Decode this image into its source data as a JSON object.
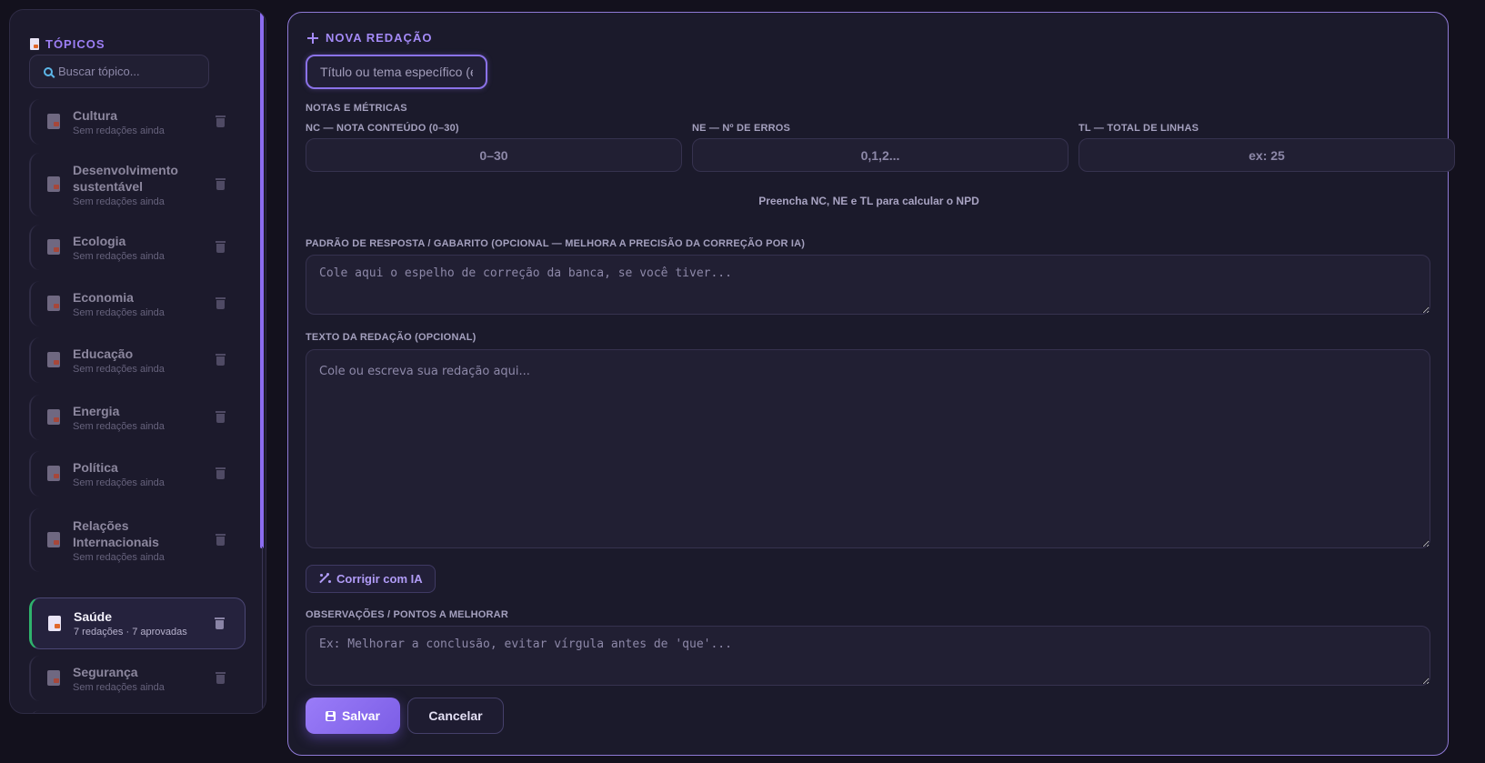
{
  "sidebar": {
    "title": "TÓPICOS",
    "search_placeholder": "Buscar tópico...",
    "topics": [
      {
        "name": "Cultura",
        "sub": "Sem redações ainda"
      },
      {
        "name": "Desenvolvimento sustentável",
        "sub": "Sem redações ainda"
      },
      {
        "name": "Ecologia",
        "sub": "Sem redações ainda"
      },
      {
        "name": "Economia",
        "sub": "Sem redações ainda"
      },
      {
        "name": "Educação",
        "sub": "Sem redações ainda"
      },
      {
        "name": "Energia",
        "sub": "Sem redações ainda"
      },
      {
        "name": "Política",
        "sub": "Sem redações ainda"
      },
      {
        "name": "Relações Internacionais",
        "sub": "Sem redações ainda"
      },
      {
        "name": "Saúde",
        "sub": "7 redações · 7 aprovadas",
        "active": true
      },
      {
        "name": "Segurança",
        "sub": "Sem redações ainda"
      }
    ]
  },
  "form": {
    "title": "NOVA REDAÇÃO",
    "title_placeholder": "Título ou tema específico (ex: ...)",
    "metrics_heading": "NOTAS E MÉTRICAS",
    "nc_label": "NC — NOTA CONTEÚDO (0–30)",
    "nc_placeholder": "0–30",
    "ne_label": "NE — Nº DE ERROS",
    "ne_placeholder": "0,1,2...",
    "tl_label": "TL — TOTAL DE LINHAS",
    "tl_placeholder": "ex: 25",
    "npd_hint": "Preencha NC, NE e TL para calcular o NPD",
    "gabarito_label": "PADRÃO DE RESPOSTA / GABARITO (OPCIONAL — MELHORA A PRECISÃO DA CORREÇÃO POR IA)",
    "gabarito_placeholder": "Cole aqui o espelho de correção da banca, se você tiver...",
    "texto_label": "TEXTO DA REDAÇÃO (OPCIONAL)",
    "texto_placeholder": "Cole ou escreva sua redação aqui...",
    "ai_button": "Corrigir com IA",
    "obs_label": "OBSERVAÇÕES / PONTOS A MELHORAR",
    "obs_placeholder": "Ex: Melhorar a conclusão, evitar vírgula antes de 'que'...",
    "save_button": "Salvar",
    "cancel_button": "Cancelar"
  },
  "colors": {
    "accent": "#9a7cf8",
    "active_topic_border": "#2fb36d",
    "background": "#13111d"
  }
}
